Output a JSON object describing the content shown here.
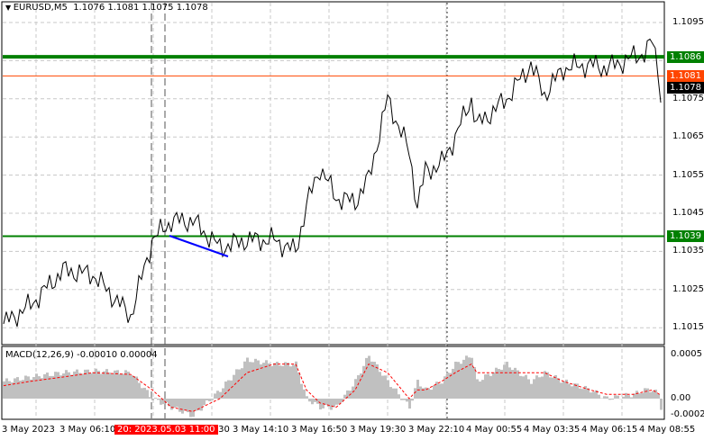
{
  "header": {
    "symbol": "EURUSD,M5",
    "ohlc": "1.1076 1.1081 1.1075 1.1078"
  },
  "macd": {
    "label": "MACD(12,26,9) -0.00010 0.00004",
    "ticks": [
      "0.0005",
      "0.00",
      "-0.0002"
    ]
  },
  "price_axis": {
    "ticks": [
      "1.1095",
      "1.1075",
      "1.1065",
      "1.1055",
      "1.1045",
      "1.1035",
      "1.1025",
      "1.1015"
    ],
    "levels": [
      {
        "value": "1.1086",
        "color": "#008000"
      },
      {
        "value": "1.1081",
        "color": "#ff4500"
      },
      {
        "value": "1.1078",
        "color": "#000000"
      },
      {
        "value": "1.1039",
        "color": "#008000"
      }
    ]
  },
  "time_axis": {
    "ticks": [
      "3 May 2023",
      "3 May 06:10",
      "11:30",
      "3 May 14:10",
      "3 May 16:50",
      "3 May 19:30",
      "3 May 22:10",
      "4 May 00:55",
      "4 May 03:35",
      "4 May 06:15",
      "4 May 08:55"
    ],
    "crosshair": "2023.05.03 11:00",
    "crosshair_prefix": "20:"
  },
  "chart_data": {
    "type": "line",
    "symbol": "EURUSD",
    "timeframe": "M5",
    "bars": [
      0,
      10,
      22,
      33,
      47,
      55,
      62,
      70,
      80,
      90,
      100,
      108,
      112,
      117,
      123,
      130,
      135,
      142,
      150,
      153,
      156,
      162,
      167,
      173,
      175,
      186,
      195,
      200,
      207,
      217,
      223,
      233,
      237,
      240,
      242,
      243
    ],
    "close": [
      1.1016,
      1.1021,
      1.103,
      1.1029,
      1.1018,
      1.1038,
      1.1043,
      1.1043,
      1.1036,
      1.1038,
      1.1038,
      1.1035,
      1.1047,
      1.1057,
      1.1049,
      1.1048,
      1.1054,
      1.1075,
      1.1061,
      1.1047,
      1.1056,
      1.1058,
      1.1065,
      1.1075,
      1.1068,
      1.1075,
      1.1084,
      1.1076,
      1.1083,
      1.1084,
      1.1083,
      1.1086,
      1.1087,
      1.109,
      1.1083,
      1.1076
    ],
    "ylim": [
      1.1008,
      1.1102
    ],
    "macd_hist": [
      0.0002,
      0.00025,
      0.0003,
      0.00032,
      0.0003,
      0.0,
      -0.0001,
      -0.0002,
      0.0001,
      0.00045,
      0.0004,
      0.0004,
      0.0,
      -0.0001,
      -0.0001,
      0.0002,
      0.0005,
      0.0002,
      -0.0001,
      0.0002,
      0.0001,
      0.0002,
      0.0004,
      0.0005,
      0.0002,
      0.0004,
      0.0002,
      0.0003,
      0.0002,
      0.0001,
      0.0,
      5e-05,
      0.0001,
      0.0001,
      5e-05,
      -0.0001
    ],
    "macd_signal": [
      0.00015,
      0.0002,
      0.00025,
      0.0003,
      0.00028,
      0.0001,
      -0.0001,
      -0.00015,
      0.0,
      0.0003,
      0.0004,
      0.0004,
      0.0001,
      -5e-05,
      -0.0001,
      0.0001,
      0.0004,
      0.0003,
      0.0,
      0.0001,
      0.0001,
      0.0002,
      0.0003,
      0.0004,
      0.0003,
      0.0003,
      0.0003,
      0.0003,
      0.0002,
      0.0001,
      5e-05,
      5e-05,
      8e-05,
      0.0001,
      6e-05,
      4e-05
    ],
    "trendline": {
      "from": [
        1.1039,
        1.1039
      ],
      "to": [
        1.1033,
        1.1033
      ]
    }
  }
}
